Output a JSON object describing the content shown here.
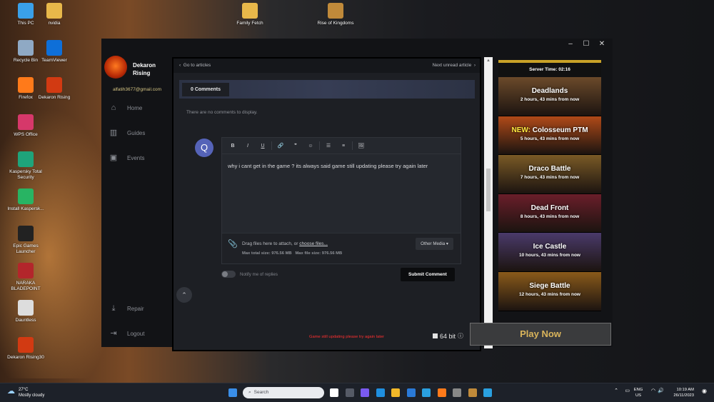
{
  "desktop": {
    "icons": [
      {
        "label": "This PC",
        "icon": "pc-icon",
        "color": "#3aa0e8"
      },
      {
        "label": "nvidia",
        "icon": "folder-icon",
        "color": "#e8b84a"
      },
      {
        "label": "Family Fetch",
        "icon": "folder-icon",
        "color": "#e8b84a"
      },
      {
        "label": "Rise of Kingdoms",
        "icon": "game-icon",
        "color": "#c08a3a"
      },
      {
        "label": "Recycle Bin",
        "icon": "recycle-bin-icon",
        "color": "#8fa9c4"
      },
      {
        "label": "TeamViewer",
        "icon": "teamviewer-icon",
        "color": "#0e6fd8"
      },
      {
        "label": "Firefox",
        "icon": "firefox-icon",
        "color": "#ff7a1a"
      },
      {
        "label": "Dekaron Rising",
        "icon": "dekaron-icon",
        "color": "#d23a12"
      },
      {
        "label": "WPS Office",
        "icon": "wps-icon",
        "color": "#d6386a"
      },
      {
        "label": "Kaspersky Total Security",
        "icon": "kaspersky-icon",
        "color": "#1fa47a"
      },
      {
        "label": "Install Kaspersk...",
        "icon": "installer-icon",
        "color": "#28b463"
      },
      {
        "label": "Epic Games Launcher",
        "icon": "epic-icon",
        "color": "#222222"
      },
      {
        "label": "NARAKA BLADEPOINT",
        "icon": "naraka-icon",
        "color": "#b3262b"
      },
      {
        "label": "Dauntless",
        "icon": "dauntless-icon",
        "color": "#dddddd"
      },
      {
        "label": "Dekaron Rising30",
        "icon": "dekaron-icon",
        "color": "#d23a12"
      }
    ]
  },
  "launcher": {
    "brand": {
      "line1": "Dekaron",
      "line2": "Rising"
    },
    "email": "alfatih3677@gmail.com",
    "nav": [
      {
        "label": "Home",
        "icon": "home-icon"
      },
      {
        "label": "Guides",
        "icon": "books-icon"
      },
      {
        "label": "Events",
        "icon": "calendar-icon"
      }
    ],
    "nav_bottom": [
      {
        "label": "Repair",
        "icon": "download-icon"
      },
      {
        "label": "Logout",
        "icon": "logout-icon"
      }
    ],
    "article": {
      "back_label": "Go to articles",
      "next_label": "Next unread article",
      "tab_label": "0 Comments",
      "empty_text": "There are no comments to display.",
      "avatar_letter": "Q",
      "toolbar": [
        "B",
        "I",
        "U",
        "🔗",
        "❞",
        "☺",
        "☰",
        "≡",
        "🖼"
      ],
      "comment_text": "why i cant get in the game ? its always said game still updating please try again later",
      "attach_text": "Drag files here to attach, or",
      "attach_link": "choose files...",
      "max_total": "Max total size: 976.56 MB",
      "max_file": "Max file size: 976.56 MB",
      "other_media": "Other Media ▾",
      "notify_label": "Notify me of replies",
      "submit_label": "Submit Comment"
    },
    "server_time": "Server Time: 02:16",
    "events": [
      {
        "new": "",
        "name": "Deadlands",
        "time": "2 hours, 43 mins from now",
        "color": "#6b4a2a"
      },
      {
        "new": "NEW:",
        "name": "Colosseum PTM",
        "time": "5 hours, 43 mins from now",
        "color": "#b04a18"
      },
      {
        "new": "",
        "name": "Draco Battle",
        "time": "7 hours, 43 mins from now",
        "color": "#7a5a26"
      },
      {
        "new": "",
        "name": "Dead Front",
        "time": "8 hours, 43 mins from now",
        "color": "#6a1e2a"
      },
      {
        "new": "",
        "name": "Ice Castle",
        "time": "10 hours, 43 mins from now",
        "color": "#4a3a6a"
      },
      {
        "new": "",
        "name": "Siege Battle",
        "time": "12 hours, 43 mins from now",
        "color": "#8a5a1a"
      }
    ],
    "status_text": "Game still updating please try again later",
    "bit_label": "64 bit",
    "play_label": "Play Now"
  },
  "taskbar": {
    "weather_temp": "27°C",
    "weather_desc": "Mostly cloudy",
    "search_placeholder": "Search",
    "lang1": "ENG",
    "lang2": "US",
    "time": "10:19 AM",
    "date": "26/11/2023",
    "apps": [
      "#ffffff",
      "#555a66",
      "#7a5af0",
      "#1f8fe0",
      "#f2b829",
      "#2a7ad8",
      "#2aa0e0",
      "#ff7a1a",
      "#888888",
      "#c08a3a",
      "#2aa0e0"
    ]
  }
}
